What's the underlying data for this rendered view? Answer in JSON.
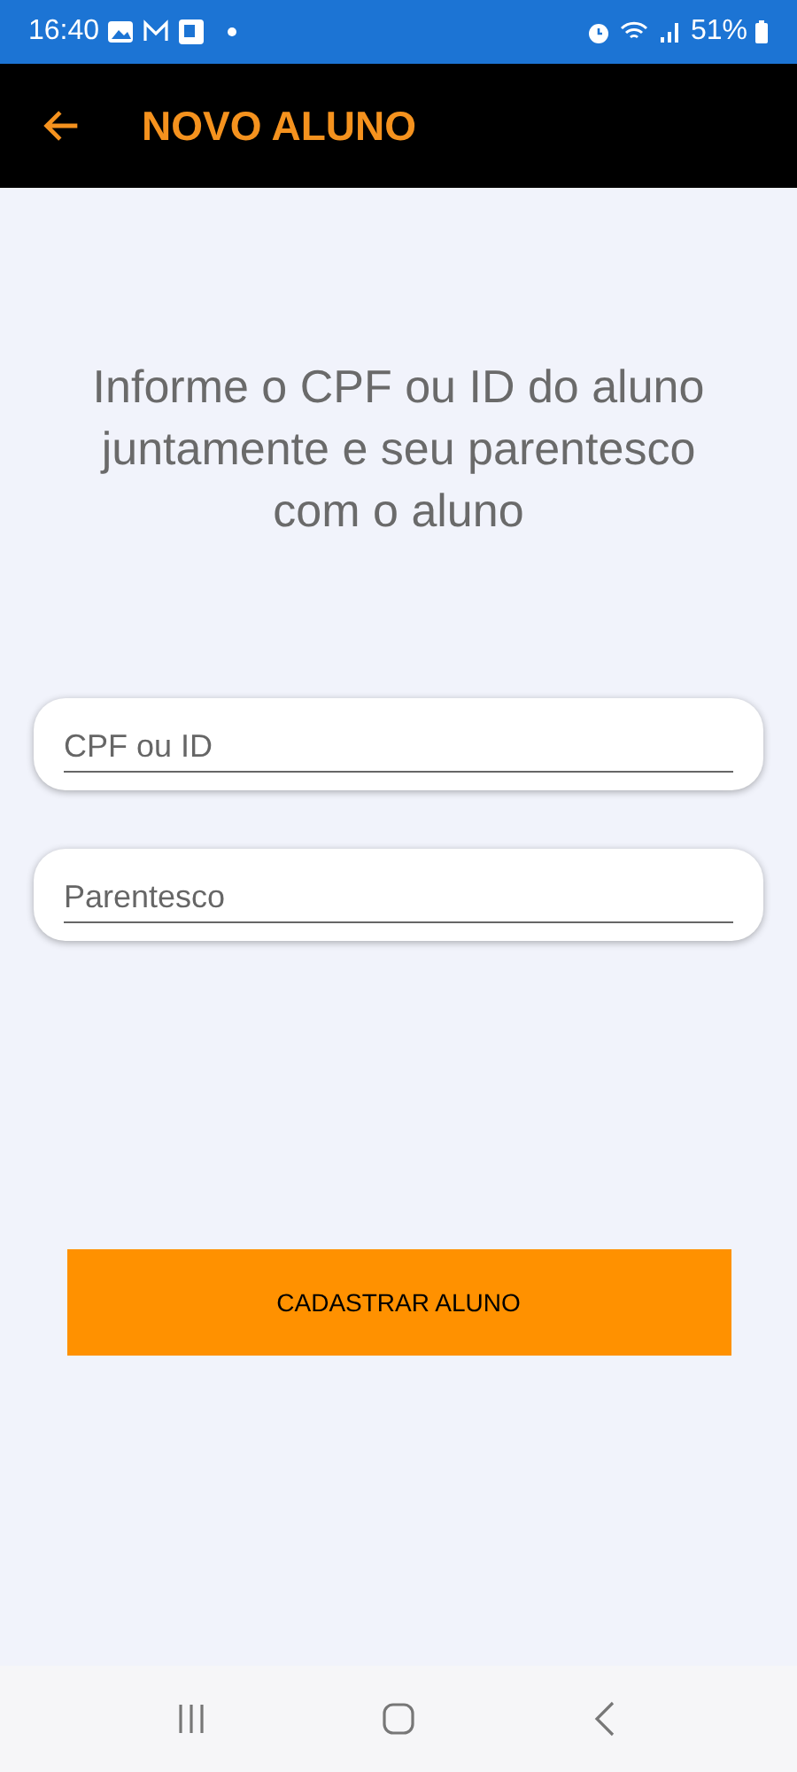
{
  "status_bar": {
    "time": "16:40",
    "battery": "51%"
  },
  "app_bar": {
    "title": "NOVO ALUNO"
  },
  "instructions": "Informe o CPF ou ID do aluno juntamente e seu parentesco com o aluno",
  "fields": [
    {
      "placeholder": "CPF ou ID"
    },
    {
      "placeholder": "Parentesco"
    }
  ],
  "submit_button": "CADASTRAR ALUNO"
}
